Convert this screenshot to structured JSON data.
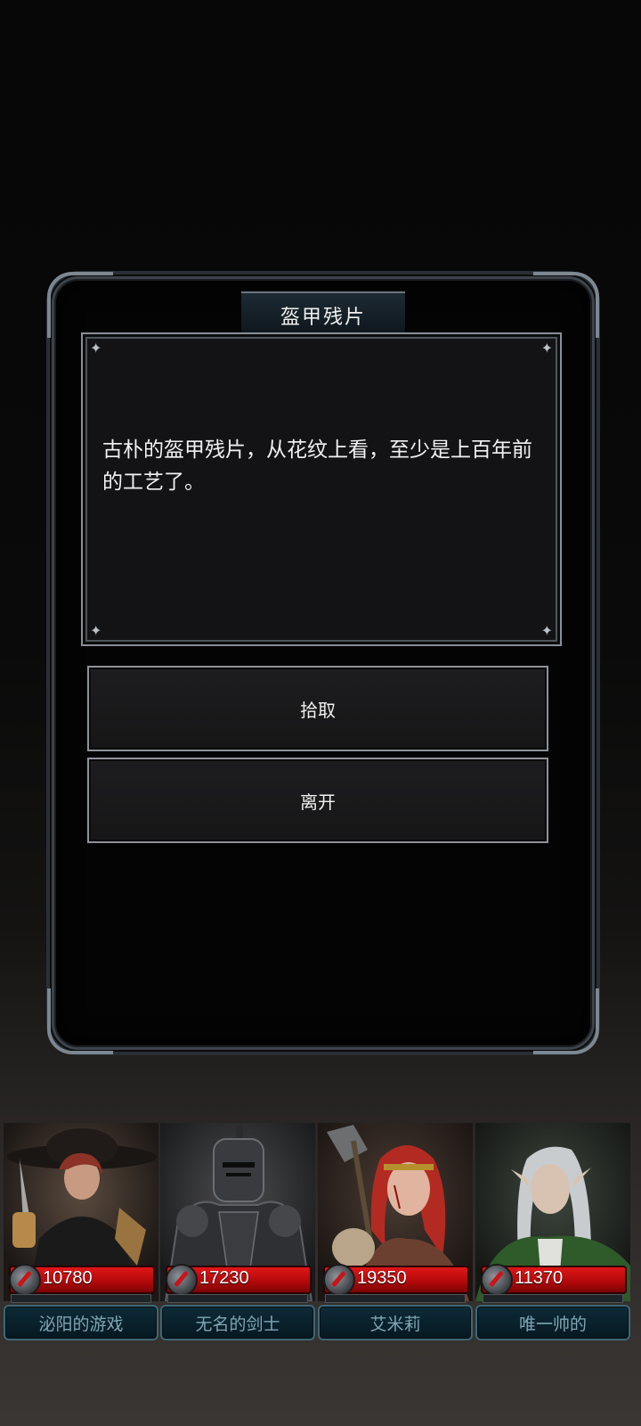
{
  "dialog": {
    "title": "盔甲残片",
    "description": "古朴的盔甲残片，从花纹上看，至少是上百年前的工艺了。",
    "options": [
      {
        "label": "拾取"
      },
      {
        "label": "离开"
      }
    ]
  },
  "party": [
    {
      "name": "泌阳的游戏",
      "hp": "10780"
    },
    {
      "name": "无名的剑士",
      "hp": "17230"
    },
    {
      "name": "艾米莉",
      "hp": "19350"
    },
    {
      "name": "唯一帅的",
      "hp": "11370"
    }
  ],
  "colors": {
    "hp_red": "#c80d10",
    "name_text": "#7fa6b5",
    "panel_border": "#8d9297"
  }
}
